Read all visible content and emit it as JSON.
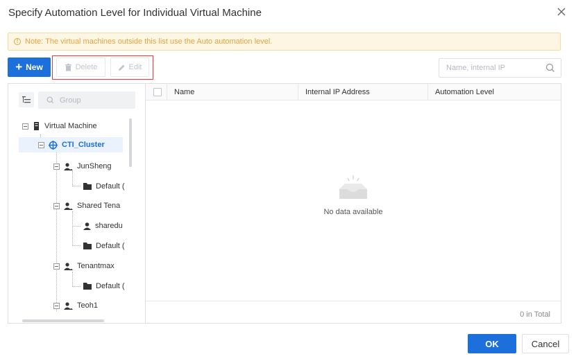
{
  "dialog": {
    "title": "Specify Automation Level for Individual Virtual Machine",
    "note": "Note: The virtual machines outside this list use the Auto automation level."
  },
  "toolbar": {
    "new_label": "New",
    "delete_label": "Delete",
    "edit_label": "Edit",
    "search_placeholder": "Name, internal IP"
  },
  "tree": {
    "group_placeholder": "Group",
    "nodes": [
      {
        "label": "Virtual Machine",
        "icon": "server-icon"
      },
      {
        "label": "CTI_Cluster",
        "icon": "cluster-icon",
        "selected": true
      },
      {
        "label": "JunSheng",
        "icon": "users-icon"
      },
      {
        "label": "Default (",
        "icon": "folder-icon"
      },
      {
        "label": "Shared Tena",
        "icon": "users-icon"
      },
      {
        "label": "sharedu",
        "icon": "user-icon"
      },
      {
        "label": "Default (",
        "icon": "folder-icon"
      },
      {
        "label": "Tenantmax",
        "icon": "users-icon"
      },
      {
        "label": "Default (",
        "icon": "folder-icon"
      },
      {
        "label": "Teoh1",
        "icon": "users-icon"
      }
    ]
  },
  "table": {
    "columns": [
      "Name",
      "Internal IP Address",
      "Automation Level"
    ],
    "empty_text": "No data available",
    "total_text": "0 in Total"
  },
  "footer": {
    "ok_label": "OK",
    "cancel_label": "Cancel"
  },
  "colors": {
    "primary": "#1d6fdc",
    "warning": "#e6a23c",
    "highlight_border": "#e53935"
  }
}
